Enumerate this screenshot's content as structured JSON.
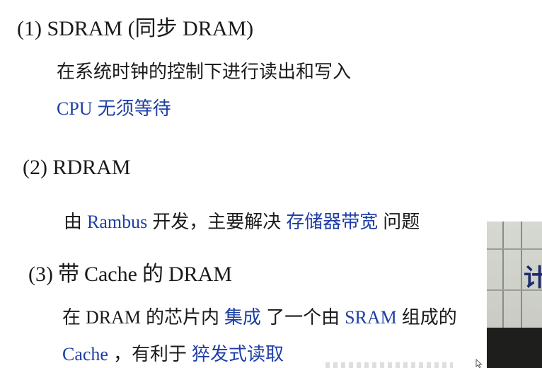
{
  "slide": {
    "l1": {
      "prefix": "(1) SDRAM (",
      "cjk": "同步",
      "suffix": " DRAM)"
    },
    "l2": "在系统时钟的控制下进行读出和写入",
    "l3": {
      "a": "CPU",
      "b": "无须等待"
    },
    "l4": "(2) RDRAM",
    "l5": {
      "a": "由",
      "b": "Rambus",
      "c": "开发，主要解决",
      "d": "存储器带宽",
      "e": "问题"
    },
    "l6": {
      "a": "(3)",
      "b": "带",
      "c": "Cache",
      "d": "的",
      "e": "DRAM"
    },
    "l7": {
      "a": "在",
      "b": "DRAM",
      "c": "的芯片内",
      "d": "集成",
      "e": "了一个由",
      "f": "SRAM",
      "g": "组成的"
    },
    "l8": {
      "a": "Cache",
      "b": "，有利于",
      "c": "猝发式读取"
    }
  },
  "video": {
    "sign_text": "计"
  },
  "colors": {
    "text": "#1a1a1a",
    "accent_blue": "#1f3fa6"
  }
}
